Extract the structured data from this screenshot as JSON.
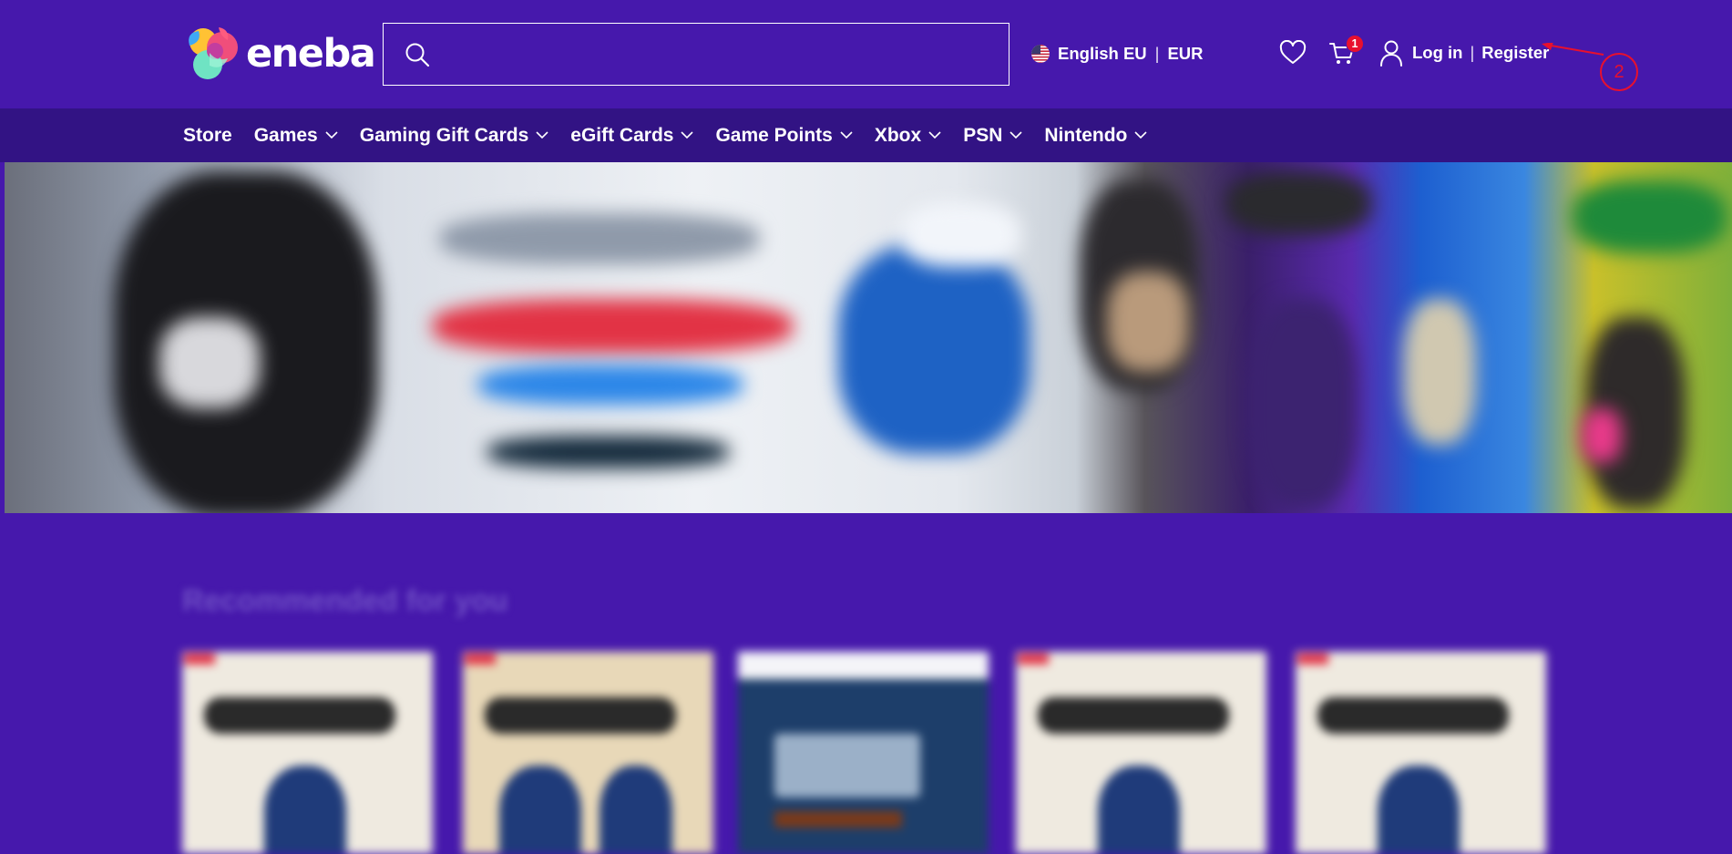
{
  "brand": {
    "name": "eneba"
  },
  "search": {
    "placeholder": "",
    "value": ""
  },
  "locale": {
    "language": "English EU",
    "separator": "|",
    "currency": "EUR"
  },
  "cart": {
    "count": "1"
  },
  "account": {
    "login": "Log in",
    "separator": "|",
    "register": "Register"
  },
  "annotation": {
    "label": "2"
  },
  "nav": {
    "items": [
      {
        "label": "Store",
        "dropdown": false
      },
      {
        "label": "Games",
        "dropdown": true
      },
      {
        "label": "Gaming Gift Cards",
        "dropdown": true
      },
      {
        "label": "eGift Cards",
        "dropdown": true
      },
      {
        "label": "Game Points",
        "dropdown": true
      },
      {
        "label": "Xbox",
        "dropdown": true
      },
      {
        "label": "PSN",
        "dropdown": true
      },
      {
        "label": "Nintendo",
        "dropdown": true
      }
    ]
  },
  "recommended": {
    "title": "Recommended for you"
  },
  "colors": {
    "primary": "#4618ac",
    "nav": "#321384",
    "badge": "#e8102e",
    "annotation": "#e8102e"
  },
  "icons": [
    "search-icon",
    "flag-icon",
    "heart-icon",
    "cart-icon",
    "user-icon",
    "chevron-down-icon"
  ]
}
